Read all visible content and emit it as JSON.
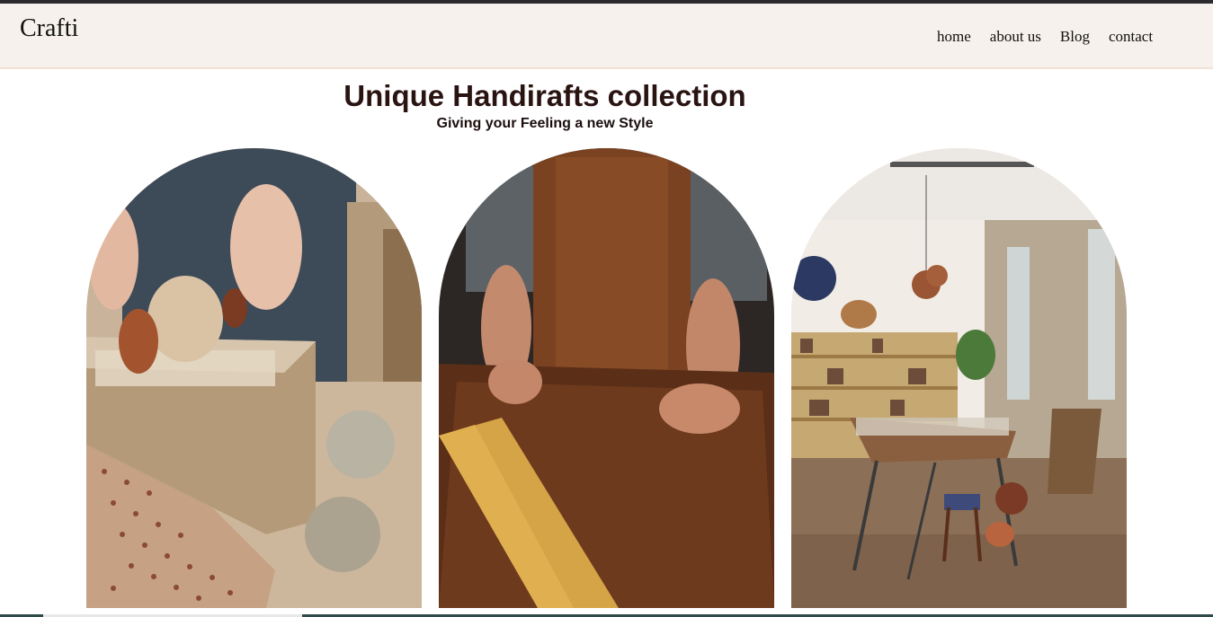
{
  "header": {
    "brand": "Crafti",
    "nav": [
      {
        "label": "home"
      },
      {
        "label": "about us"
      },
      {
        "label": "Blog"
      },
      {
        "label": "contact"
      }
    ]
  },
  "hero": {
    "title": "Unique Handirafts collection",
    "subtitle": "Giving your Feeling a new Style"
  },
  "gallery": {
    "images": [
      {
        "subject": "pottery-packing-photo"
      },
      {
        "subject": "leather-crafting-photo"
      },
      {
        "subject": "craft-shop-interior-photo"
      }
    ]
  },
  "colors": {
    "header_bg": "#f6f1ec",
    "topbar": "#2b2b2f",
    "title_text": "#2a1412"
  }
}
